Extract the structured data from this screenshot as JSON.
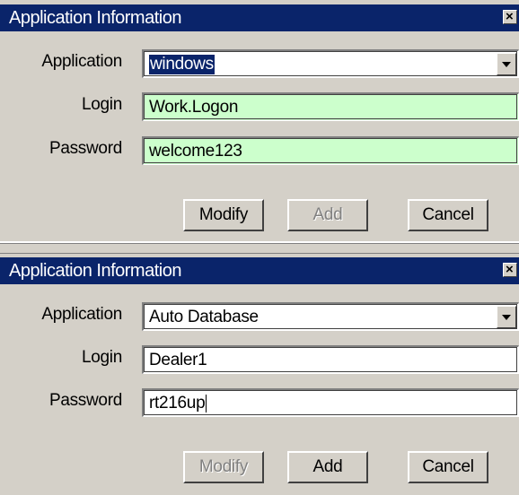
{
  "dialogs": [
    {
      "title": "Application Information",
      "fields": {
        "application_label": "Application",
        "application_value": "windows",
        "login_label": "Login",
        "login_value": "Work.Logon",
        "password_label": "Password",
        "password_value": "welcome123"
      },
      "buttons": {
        "modify": "Modify",
        "add": "Add",
        "cancel": "Cancel"
      },
      "add_enabled": false,
      "modify_enabled": true,
      "field_color": "#ccffcc"
    },
    {
      "title": "Application Information",
      "fields": {
        "application_label": "Application",
        "application_value": "Auto Database",
        "login_label": "Login",
        "login_value": "Dealer1",
        "password_label": "Password",
        "password_value": "rt216up"
      },
      "buttons": {
        "modify": "Modify",
        "add": "Add",
        "cancel": "Cancel"
      },
      "add_enabled": true,
      "modify_enabled": false,
      "field_color": "#ffffff"
    }
  ],
  "colors": {
    "titlebar": "#0a246a",
    "dialog_bg": "#d4d0c8",
    "highlight": "#0a246a"
  },
  "icons": {
    "close": "close-icon",
    "dropdown": "chevron-down-icon"
  }
}
